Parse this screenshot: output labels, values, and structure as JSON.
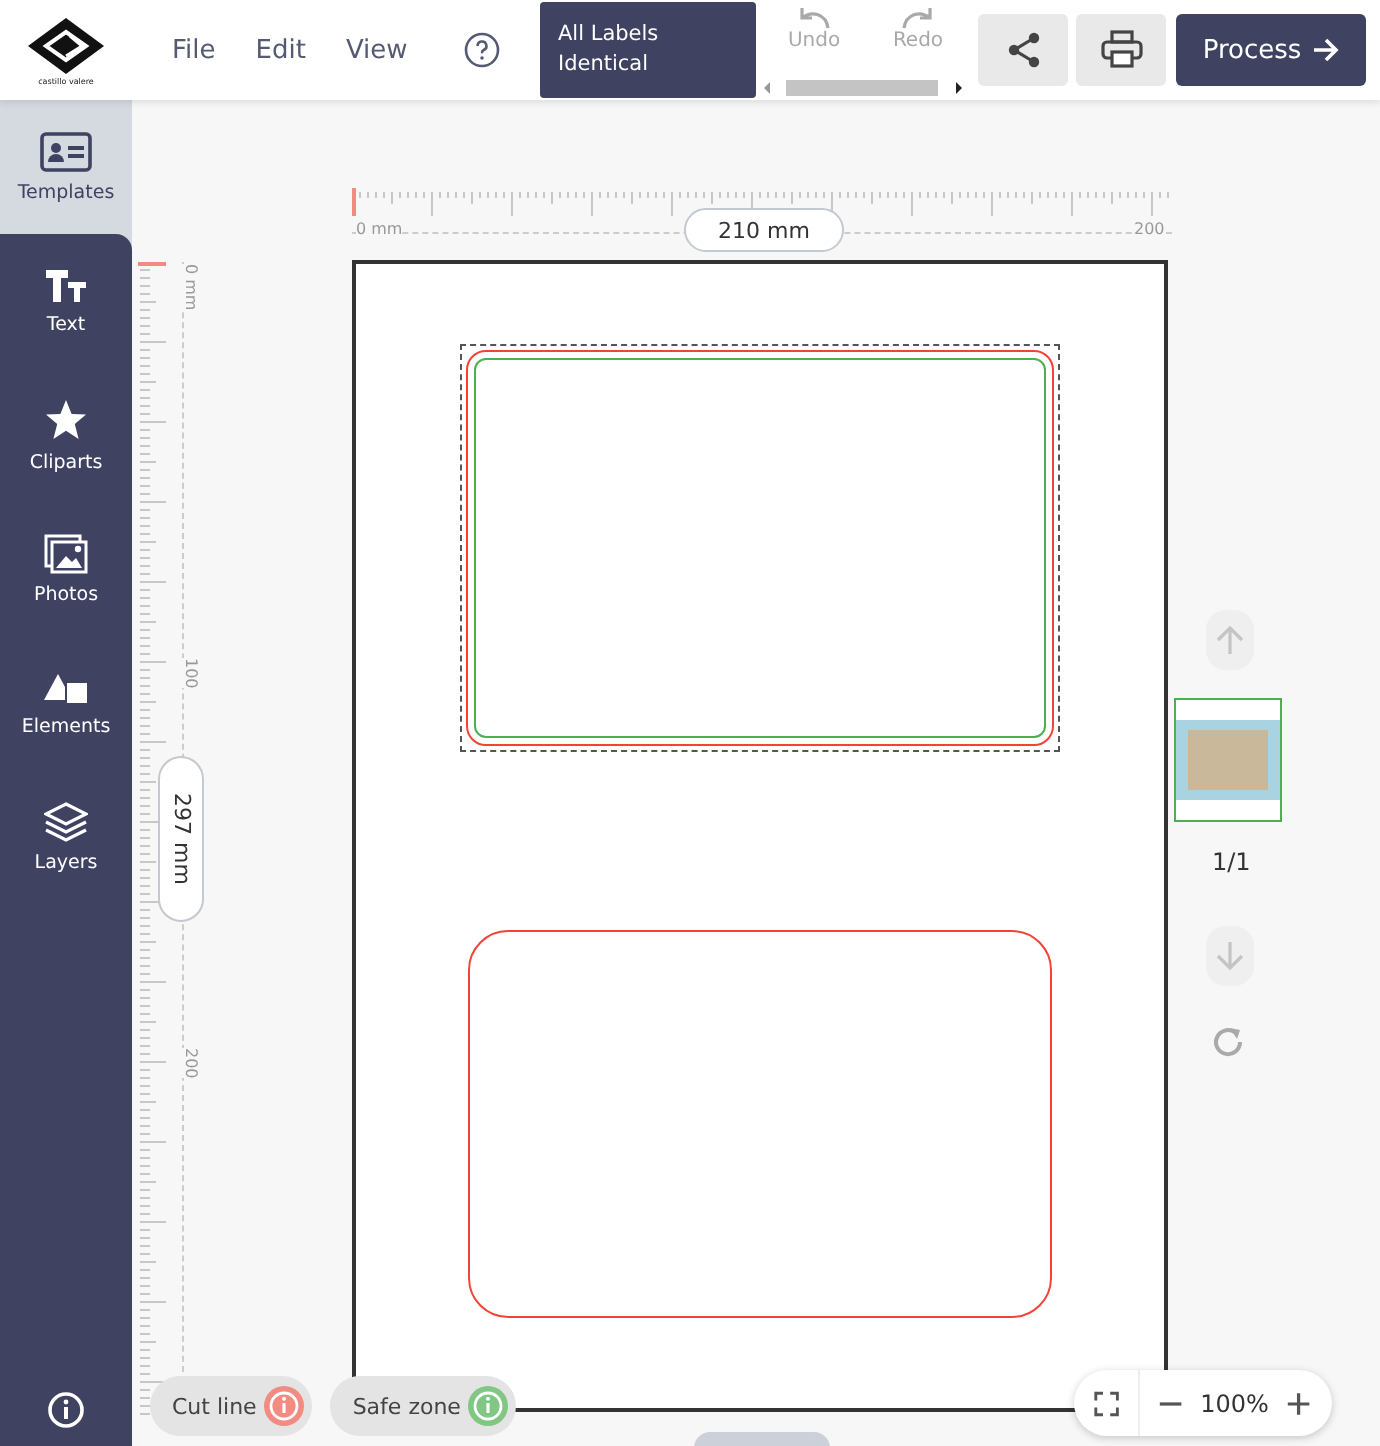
{
  "logo": {
    "text": "castillo valere"
  },
  "menu": [
    {
      "label": "File"
    },
    {
      "label": "Edit"
    },
    {
      "label": "View"
    }
  ],
  "mode_button": {
    "line_1": "All Labels",
    "line_2": "Identical"
  },
  "history": [
    {
      "kind": "undo",
      "label": "Undo",
      "disabled": true
    },
    {
      "kind": "redo",
      "label": "Redo",
      "disabled": true
    }
  ],
  "process_button": {
    "label": "Process"
  },
  "sidebar": {
    "items": [
      {
        "kind": "templates",
        "label": "Templates",
        "selected": true
      },
      {
        "kind": "text",
        "label": "Text",
        "selected": false
      },
      {
        "kind": "cliparts",
        "label": "Cliparts",
        "selected": false
      },
      {
        "kind": "photos",
        "label": "Photos",
        "selected": false
      },
      {
        "kind": "elements",
        "label": "Elements",
        "selected": false
      },
      {
        "kind": "layers",
        "label": "Layers",
        "selected": false
      }
    ]
  },
  "ruler_horizontal": {
    "start": "0 mm",
    "end": "200",
    "size": "210 mm"
  },
  "ruler_vertical": {
    "marks": [
      "0 mm",
      "100",
      "200"
    ],
    "size": "297 mm"
  },
  "labels": [
    {
      "selected": true
    },
    {
      "selected": false
    }
  ],
  "pages": {
    "counter": "1/1",
    "up_disabled": true,
    "down_disabled": true
  },
  "legend": [
    {
      "label": "Cut line",
      "color": "#f28b82"
    },
    {
      "label": "Safe zone",
      "color": "#81c784"
    }
  ],
  "zoom": {
    "value": "100%"
  }
}
